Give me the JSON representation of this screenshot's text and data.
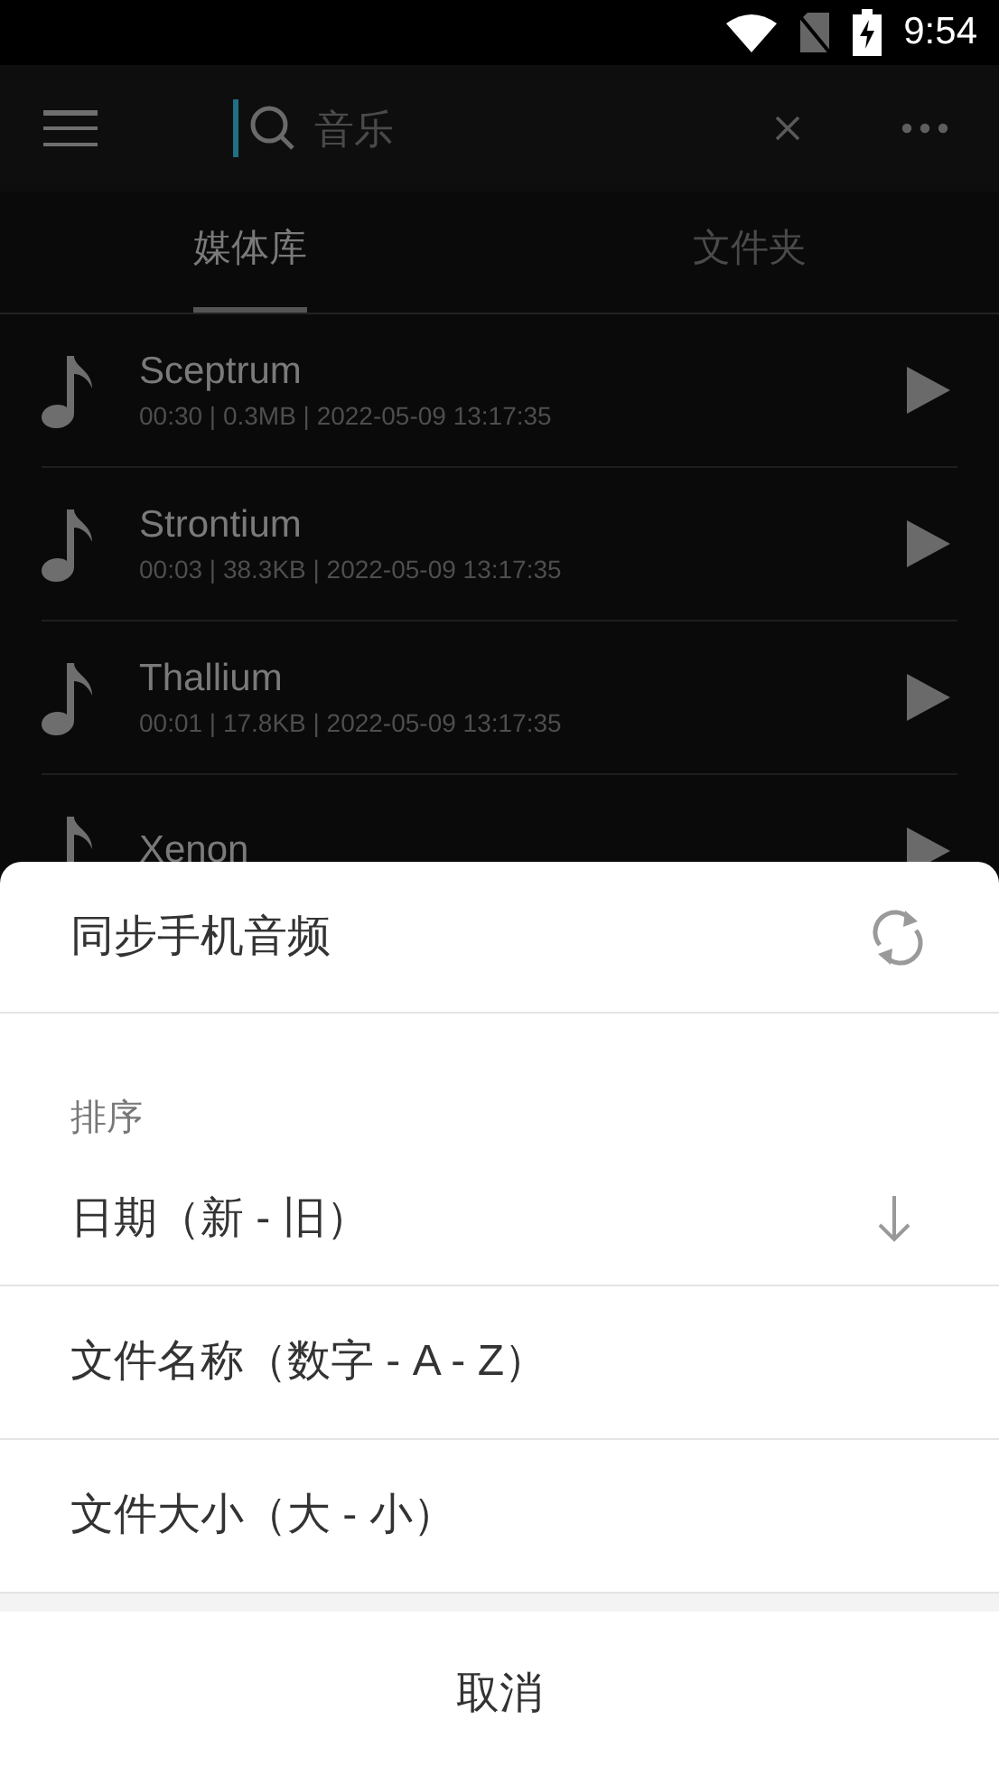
{
  "status_bar": {
    "time": "9:54"
  },
  "search": {
    "placeholder": "音乐"
  },
  "tabs": [
    {
      "label": "媒体库",
      "selected": true
    },
    {
      "label": "文件夹",
      "selected": false
    }
  ],
  "tracks": [
    {
      "title": "Sceptrum",
      "details": "00:30 | 0.3MB | 2022-05-09 13:17:35"
    },
    {
      "title": "Strontium",
      "details": "00:03 | 38.3KB | 2022-05-09 13:17:35"
    },
    {
      "title": "Thallium",
      "details": "00:01 | 17.8KB | 2022-05-09 13:17:35"
    },
    {
      "title": "Xenon"
    }
  ],
  "sheet": {
    "sync_label": "同步手机音频",
    "sort_heading": "排序",
    "sort_options": [
      {
        "label": "日期（新 - 旧）",
        "selected": true
      },
      {
        "label": "文件名称（数字 - A - Z）",
        "selected": false
      },
      {
        "label": "文件大小（大 - 小）",
        "selected": false
      }
    ],
    "cancel": "取消"
  }
}
